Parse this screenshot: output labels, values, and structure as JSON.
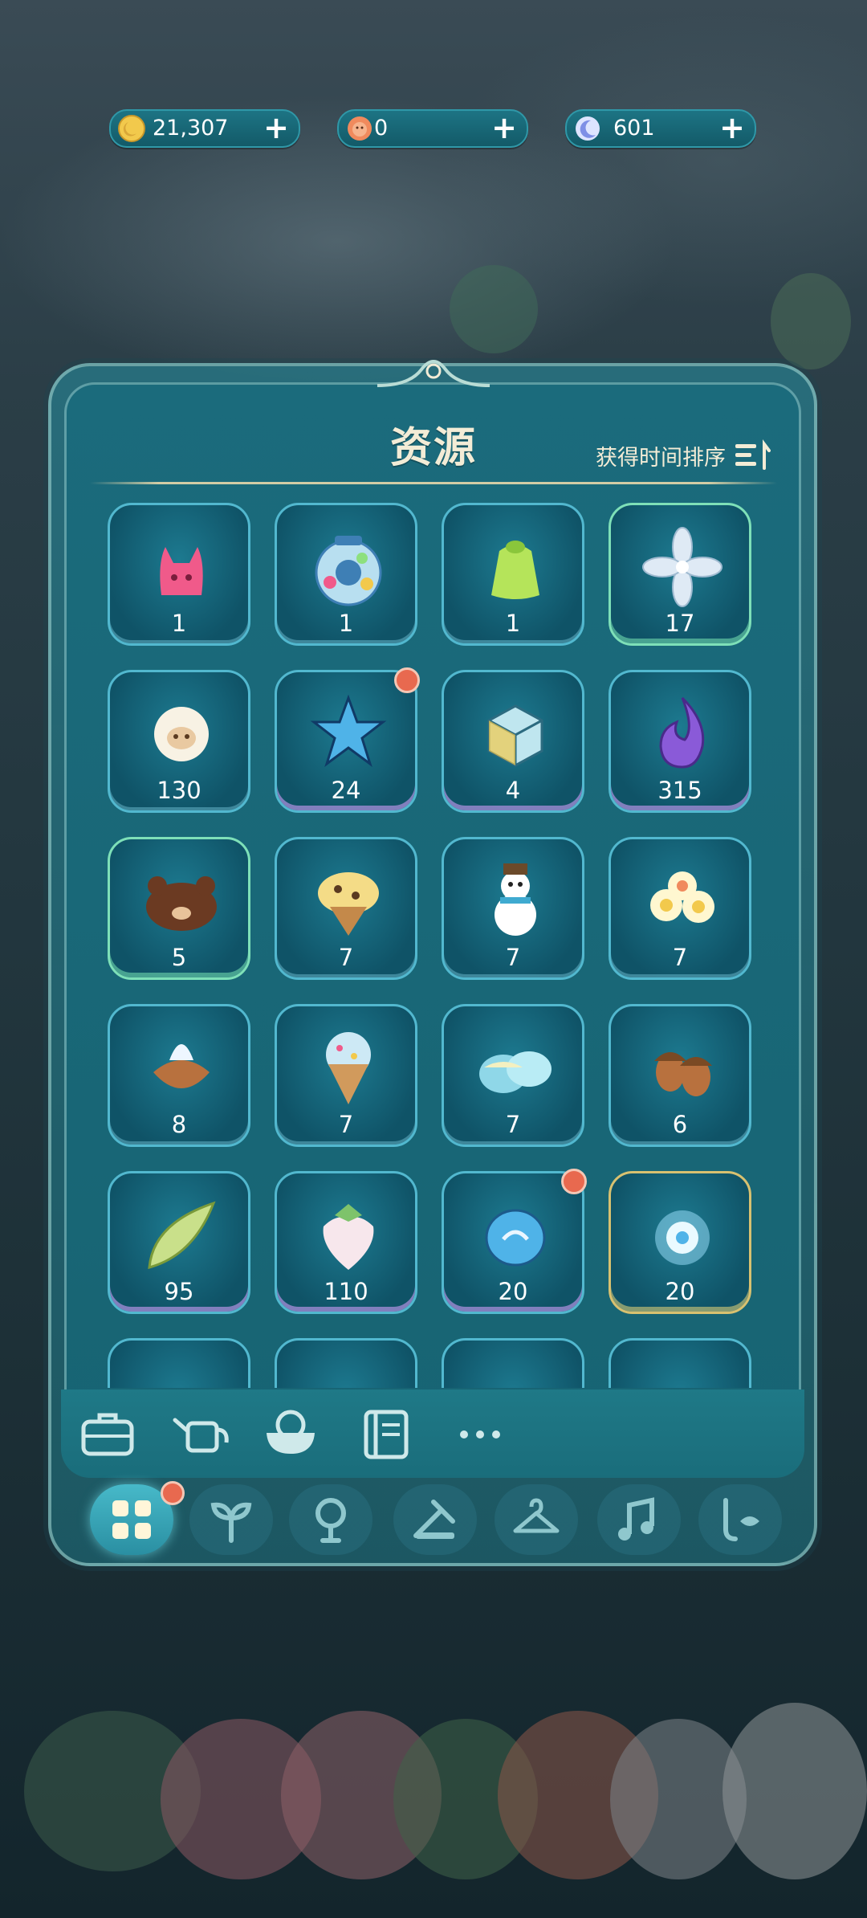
{
  "currencies": [
    {
      "name": "coin",
      "value": "21,307",
      "color": "#f2c94c"
    },
    {
      "name": "flower-token",
      "value": "0",
      "color": "#f08a5d"
    },
    {
      "name": "moon-token",
      "value": "601",
      "color": "#7e8fe6"
    }
  ],
  "panel": {
    "title": "资源",
    "sort_label": "获得时间排序"
  },
  "items": [
    {
      "icon": "pink-cat-icon",
      "count": "1",
      "badge": false,
      "style": ""
    },
    {
      "icon": "candy-jar-icon",
      "count": "1",
      "badge": false,
      "style": ""
    },
    {
      "icon": "green-jelly-icon",
      "count": "1",
      "badge": false,
      "style": ""
    },
    {
      "icon": "white-flower-icon",
      "count": "17",
      "badge": false,
      "style": "green"
    },
    {
      "icon": "sheep-icon",
      "count": "130",
      "badge": false,
      "style": ""
    },
    {
      "icon": "blue-star-icon",
      "count": "24",
      "badge": true,
      "style": "purple"
    },
    {
      "icon": "crystal-cube-icon",
      "count": "4",
      "badge": false,
      "style": "purple"
    },
    {
      "icon": "purple-flame-icon",
      "count": "315",
      "badge": false,
      "style": "purple"
    },
    {
      "icon": "bear-donut-icon",
      "count": "5",
      "badge": false,
      "style": "green"
    },
    {
      "icon": "chip-cookie-icon",
      "count": "7",
      "badge": false,
      "style": ""
    },
    {
      "icon": "snowman-icon",
      "count": "7",
      "badge": false,
      "style": ""
    },
    {
      "icon": "daisy-bunch-icon",
      "count": "7",
      "badge": false,
      "style": ""
    },
    {
      "icon": "taiyaki-icecream-icon",
      "count": "8",
      "badge": false,
      "style": ""
    },
    {
      "icon": "rainbow-cone-icon",
      "count": "7",
      "badge": false,
      "style": ""
    },
    {
      "icon": "blue-dumpling-icon",
      "count": "7",
      "badge": false,
      "style": ""
    },
    {
      "icon": "acorn-icon",
      "count": "6",
      "badge": false,
      "style": ""
    },
    {
      "icon": "bamboo-shoot-icon",
      "count": "95",
      "badge": false,
      "style": "purple"
    },
    {
      "icon": "strawberry-icon",
      "count": "110",
      "badge": false,
      "style": "purple"
    },
    {
      "icon": "blue-shell-icon",
      "count": "20",
      "badge": true,
      "style": "purple"
    },
    {
      "icon": "spirit-orb-icon",
      "count": "20",
      "badge": false,
      "style": "gold"
    }
  ],
  "toolbar": [
    "briefcase-icon",
    "watering-can-icon",
    "food-bowl-icon",
    "book-icon",
    "more-icon"
  ],
  "tabs": [
    {
      "icon": "grid-icon",
      "active": true,
      "badge": true
    },
    {
      "icon": "sprout-icon",
      "active": false,
      "badge": false
    },
    {
      "icon": "tree-icon",
      "active": false,
      "badge": false
    },
    {
      "icon": "tools-icon",
      "active": false,
      "badge": false
    },
    {
      "icon": "hanger-icon",
      "active": false,
      "badge": false
    },
    {
      "icon": "music-icon",
      "active": false,
      "badge": false
    },
    {
      "icon": "fishing-icon",
      "active": false,
      "badge": false
    }
  ]
}
